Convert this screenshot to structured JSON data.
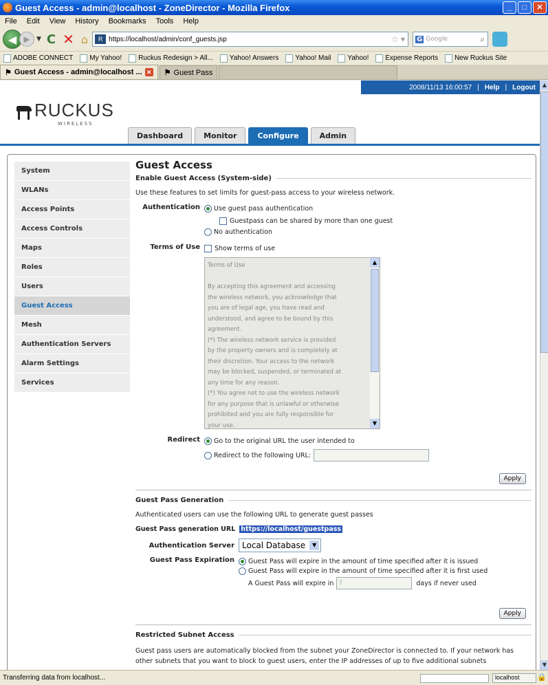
{
  "window": {
    "title": "Guest Access - admin@localhost - ZoneDirector - Mozilla Firefox"
  },
  "menubar": [
    "File",
    "Edit",
    "View",
    "History",
    "Bookmarks",
    "Tools",
    "Help"
  ],
  "navbar": {
    "url": "https://localhost/admin/conf_guests.jsp",
    "search_placeholder": "Google"
  },
  "bookmarks": [
    "ADOBE CONNECT",
    "My Yahoo!",
    "Ruckus Redesign > All...",
    "Yahoo! Answers",
    "Yahoo! Mail",
    "Yahoo!",
    "Expense Reports",
    "New Ruckus Site"
  ],
  "tabs": [
    {
      "label": "Guest Access - admin@localhost ..."
    },
    {
      "label": "Guest Pass"
    }
  ],
  "header": {
    "logo_text": "RUCKUS",
    "logo_sub": "WIRELESS",
    "timestamp": "2008/11/13 16:00:57",
    "help": "Help",
    "logout": "Logout",
    "main_tabs": [
      "Dashboard",
      "Monitor",
      "Configure",
      "Admin"
    ]
  },
  "sidebar": {
    "items": [
      "System",
      "WLANs",
      "Access Points",
      "Access Controls",
      "Maps",
      "Roles",
      "Users",
      "Guest Access",
      "Mesh",
      "Authentication Servers",
      "Alarm Settings",
      "Services"
    ],
    "active": "Guest Access"
  },
  "page": {
    "title": "Guest Access",
    "guest_access": {
      "heading": "Enable Guest Access (System-side)",
      "intro": "Use these features to set limits for guest-pass access to your wireless network.",
      "auth_label": "Authentication",
      "auth_opt1": "Use guest pass authentication",
      "auth_shared": "Guestpass can be shared by more than one guest",
      "auth_opt2": "No authentication",
      "terms_label": "Terms of Use",
      "terms_check": "Show terms of use",
      "terms_text": "Terms of Use\n\nBy accepting this agreement and accessing\nthe wireless network, you acknowledge that\nyou are of legal age, you have read and\nunderstood, and agree to be bound by this\nagreement.\n(*) The wireless network service is provided\nby the property owners and is completely at\ntheir discretion. Your access to the network\nmay be blocked, suspended, or terminated at\nany time for any reason.\n(*) You agree not to use the wireless network\nfor any purpose that is unlawful or otherwise\nprohibited and you are fully responsible for\nyour use.",
      "redirect_label": "Redirect",
      "redirect_opt1": "Go to the original URL the user intended to",
      "redirect_opt2": "Redirect to the following URL:",
      "apply": "Apply"
    },
    "pass_gen": {
      "heading": "Guest Pass Generation",
      "intro": "Authenticated users can use the following URL to generate guest passes",
      "url_label": "Guest Pass generation URL",
      "url_value": "https://localhost/guestpass",
      "server_label": "Authentication Server",
      "server_value": "Local Database",
      "expiration_label": "Guest Pass Expiration",
      "exp_opt1": "Guest Pass will expire in the amount of time specified after it is issued",
      "exp_opt2": "Guest Pass will expire in the amount of time specified after it is first used",
      "expire_prefix": "A Guest Pass will expire in",
      "expire_value": "7",
      "expire_suffix": "days if never used",
      "apply": "Apply"
    },
    "restricted": {
      "heading": "Restricted Subnet Access",
      "text": "Guest pass users are automatically blocked from the subnet your ZoneDirector is connected to. If your network has other subnets that you want to block to guest users, enter the IP addresses of up to five additional subnets"
    }
  },
  "statusbar": {
    "text": "Transferring data from localhost...",
    "host": "localhost"
  }
}
